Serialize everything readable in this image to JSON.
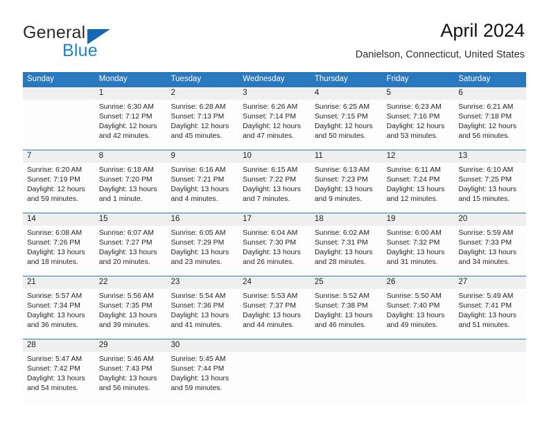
{
  "brand": {
    "word1": "General",
    "word2": "Blue",
    "triangle_color": "#1668b3",
    "blue_color": "#1b84d0"
  },
  "header": {
    "title": "April 2024",
    "subtitle": "Danielson, Connecticut, United States",
    "header_bg": "#2a78bd",
    "daynum_bg": "#efefef"
  },
  "weekdays": [
    "Sunday",
    "Monday",
    "Tuesday",
    "Wednesday",
    "Thursday",
    "Friday",
    "Saturday"
  ],
  "weeks": [
    {
      "days": [
        {
          "num": "",
          "sunrise": "",
          "sunset": "",
          "daylight1": "",
          "daylight2": ""
        },
        {
          "num": "1",
          "sunrise": "Sunrise: 6:30 AM",
          "sunset": "Sunset: 7:12 PM",
          "daylight1": "Daylight: 12 hours",
          "daylight2": "and 42 minutes."
        },
        {
          "num": "2",
          "sunrise": "Sunrise: 6:28 AM",
          "sunset": "Sunset: 7:13 PM",
          "daylight1": "Daylight: 12 hours",
          "daylight2": "and 45 minutes."
        },
        {
          "num": "3",
          "sunrise": "Sunrise: 6:26 AM",
          "sunset": "Sunset: 7:14 PM",
          "daylight1": "Daylight: 12 hours",
          "daylight2": "and 47 minutes."
        },
        {
          "num": "4",
          "sunrise": "Sunrise: 6:25 AM",
          "sunset": "Sunset: 7:15 PM",
          "daylight1": "Daylight: 12 hours",
          "daylight2": "and 50 minutes."
        },
        {
          "num": "5",
          "sunrise": "Sunrise: 6:23 AM",
          "sunset": "Sunset: 7:16 PM",
          "daylight1": "Daylight: 12 hours",
          "daylight2": "and 53 minutes."
        },
        {
          "num": "6",
          "sunrise": "Sunrise: 6:21 AM",
          "sunset": "Sunset: 7:18 PM",
          "daylight1": "Daylight: 12 hours",
          "daylight2": "and 56 minutes."
        }
      ]
    },
    {
      "days": [
        {
          "num": "7",
          "sunrise": "Sunrise: 6:20 AM",
          "sunset": "Sunset: 7:19 PM",
          "daylight1": "Daylight: 12 hours",
          "daylight2": "and 59 minutes."
        },
        {
          "num": "8",
          "sunrise": "Sunrise: 6:18 AM",
          "sunset": "Sunset: 7:20 PM",
          "daylight1": "Daylight: 13 hours",
          "daylight2": "and 1 minute."
        },
        {
          "num": "9",
          "sunrise": "Sunrise: 6:16 AM",
          "sunset": "Sunset: 7:21 PM",
          "daylight1": "Daylight: 13 hours",
          "daylight2": "and 4 minutes."
        },
        {
          "num": "10",
          "sunrise": "Sunrise: 6:15 AM",
          "sunset": "Sunset: 7:22 PM",
          "daylight1": "Daylight: 13 hours",
          "daylight2": "and 7 minutes."
        },
        {
          "num": "11",
          "sunrise": "Sunrise: 6:13 AM",
          "sunset": "Sunset: 7:23 PM",
          "daylight1": "Daylight: 13 hours",
          "daylight2": "and 9 minutes."
        },
        {
          "num": "12",
          "sunrise": "Sunrise: 6:11 AM",
          "sunset": "Sunset: 7:24 PM",
          "daylight1": "Daylight: 13 hours",
          "daylight2": "and 12 minutes."
        },
        {
          "num": "13",
          "sunrise": "Sunrise: 6:10 AM",
          "sunset": "Sunset: 7:25 PM",
          "daylight1": "Daylight: 13 hours",
          "daylight2": "and 15 minutes."
        }
      ]
    },
    {
      "days": [
        {
          "num": "14",
          "sunrise": "Sunrise: 6:08 AM",
          "sunset": "Sunset: 7:26 PM",
          "daylight1": "Daylight: 13 hours",
          "daylight2": "and 18 minutes."
        },
        {
          "num": "15",
          "sunrise": "Sunrise: 6:07 AM",
          "sunset": "Sunset: 7:27 PM",
          "daylight1": "Daylight: 13 hours",
          "daylight2": "and 20 minutes."
        },
        {
          "num": "16",
          "sunrise": "Sunrise: 6:05 AM",
          "sunset": "Sunset: 7:29 PM",
          "daylight1": "Daylight: 13 hours",
          "daylight2": "and 23 minutes."
        },
        {
          "num": "17",
          "sunrise": "Sunrise: 6:04 AM",
          "sunset": "Sunset: 7:30 PM",
          "daylight1": "Daylight: 13 hours",
          "daylight2": "and 26 minutes."
        },
        {
          "num": "18",
          "sunrise": "Sunrise: 6:02 AM",
          "sunset": "Sunset: 7:31 PM",
          "daylight1": "Daylight: 13 hours",
          "daylight2": "and 28 minutes."
        },
        {
          "num": "19",
          "sunrise": "Sunrise: 6:00 AM",
          "sunset": "Sunset: 7:32 PM",
          "daylight1": "Daylight: 13 hours",
          "daylight2": "and 31 minutes."
        },
        {
          "num": "20",
          "sunrise": "Sunrise: 5:59 AM",
          "sunset": "Sunset: 7:33 PM",
          "daylight1": "Daylight: 13 hours",
          "daylight2": "and 34 minutes."
        }
      ]
    },
    {
      "days": [
        {
          "num": "21",
          "sunrise": "Sunrise: 5:57 AM",
          "sunset": "Sunset: 7:34 PM",
          "daylight1": "Daylight: 13 hours",
          "daylight2": "and 36 minutes."
        },
        {
          "num": "22",
          "sunrise": "Sunrise: 5:56 AM",
          "sunset": "Sunset: 7:35 PM",
          "daylight1": "Daylight: 13 hours",
          "daylight2": "and 39 minutes."
        },
        {
          "num": "23",
          "sunrise": "Sunrise: 5:54 AM",
          "sunset": "Sunset: 7:36 PM",
          "daylight1": "Daylight: 13 hours",
          "daylight2": "and 41 minutes."
        },
        {
          "num": "24",
          "sunrise": "Sunrise: 5:53 AM",
          "sunset": "Sunset: 7:37 PM",
          "daylight1": "Daylight: 13 hours",
          "daylight2": "and 44 minutes."
        },
        {
          "num": "25",
          "sunrise": "Sunrise: 5:52 AM",
          "sunset": "Sunset: 7:38 PM",
          "daylight1": "Daylight: 13 hours",
          "daylight2": "and 46 minutes."
        },
        {
          "num": "26",
          "sunrise": "Sunrise: 5:50 AM",
          "sunset": "Sunset: 7:40 PM",
          "daylight1": "Daylight: 13 hours",
          "daylight2": "and 49 minutes."
        },
        {
          "num": "27",
          "sunrise": "Sunrise: 5:49 AM",
          "sunset": "Sunset: 7:41 PM",
          "daylight1": "Daylight: 13 hours",
          "daylight2": "and 51 minutes."
        }
      ]
    },
    {
      "days": [
        {
          "num": "28",
          "sunrise": "Sunrise: 5:47 AM",
          "sunset": "Sunset: 7:42 PM",
          "daylight1": "Daylight: 13 hours",
          "daylight2": "and 54 minutes."
        },
        {
          "num": "29",
          "sunrise": "Sunrise: 5:46 AM",
          "sunset": "Sunset: 7:43 PM",
          "daylight1": "Daylight: 13 hours",
          "daylight2": "and 56 minutes."
        },
        {
          "num": "30",
          "sunrise": "Sunrise: 5:45 AM",
          "sunset": "Sunset: 7:44 PM",
          "daylight1": "Daylight: 13 hours",
          "daylight2": "and 59 minutes."
        },
        {
          "num": "",
          "sunrise": "",
          "sunset": "",
          "daylight1": "",
          "daylight2": ""
        },
        {
          "num": "",
          "sunrise": "",
          "sunset": "",
          "daylight1": "",
          "daylight2": ""
        },
        {
          "num": "",
          "sunrise": "",
          "sunset": "",
          "daylight1": "",
          "daylight2": ""
        },
        {
          "num": "",
          "sunrise": "",
          "sunset": "",
          "daylight1": "",
          "daylight2": ""
        }
      ]
    }
  ]
}
